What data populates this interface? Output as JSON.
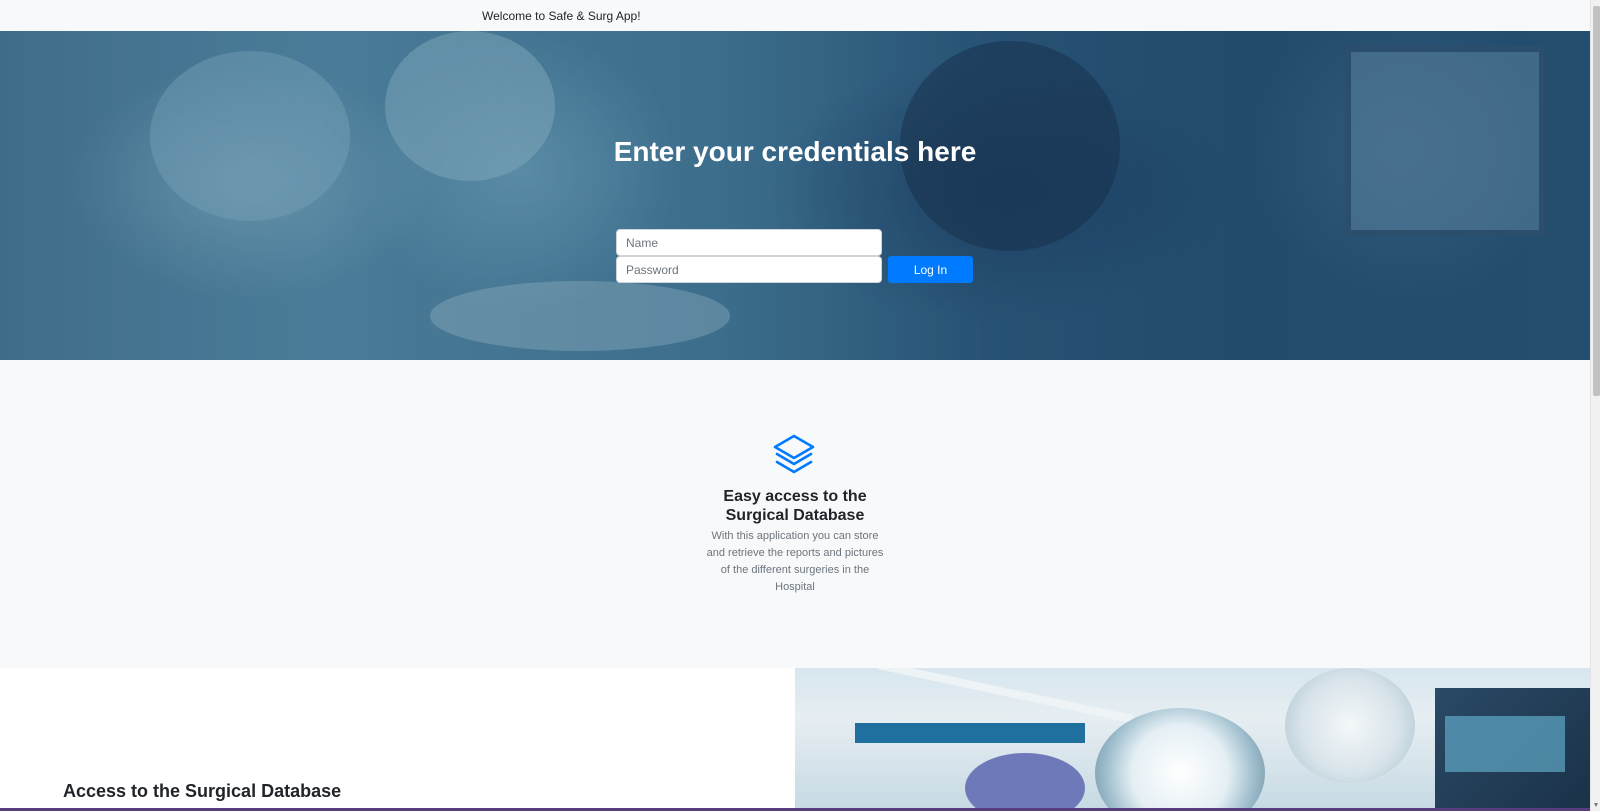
{
  "navbar": {
    "brand": "Welcome to Safe & Surg App!"
  },
  "hero": {
    "title": "Enter your credentials here",
    "name_placeholder": "Name",
    "password_placeholder": "Password",
    "login_label": "Log In"
  },
  "feature": {
    "icon": "layers-icon",
    "title": "Easy access to the Surgical Database",
    "text": "With this application you can store and retrieve the reports and pictures of the different surgeries in the Hospital"
  },
  "showcase": {
    "title": "Access to the Surgical Database"
  },
  "colors": {
    "primary": "#007bff",
    "hero_overlay": "#2e5a7c",
    "accent_line": "#563d7c"
  }
}
